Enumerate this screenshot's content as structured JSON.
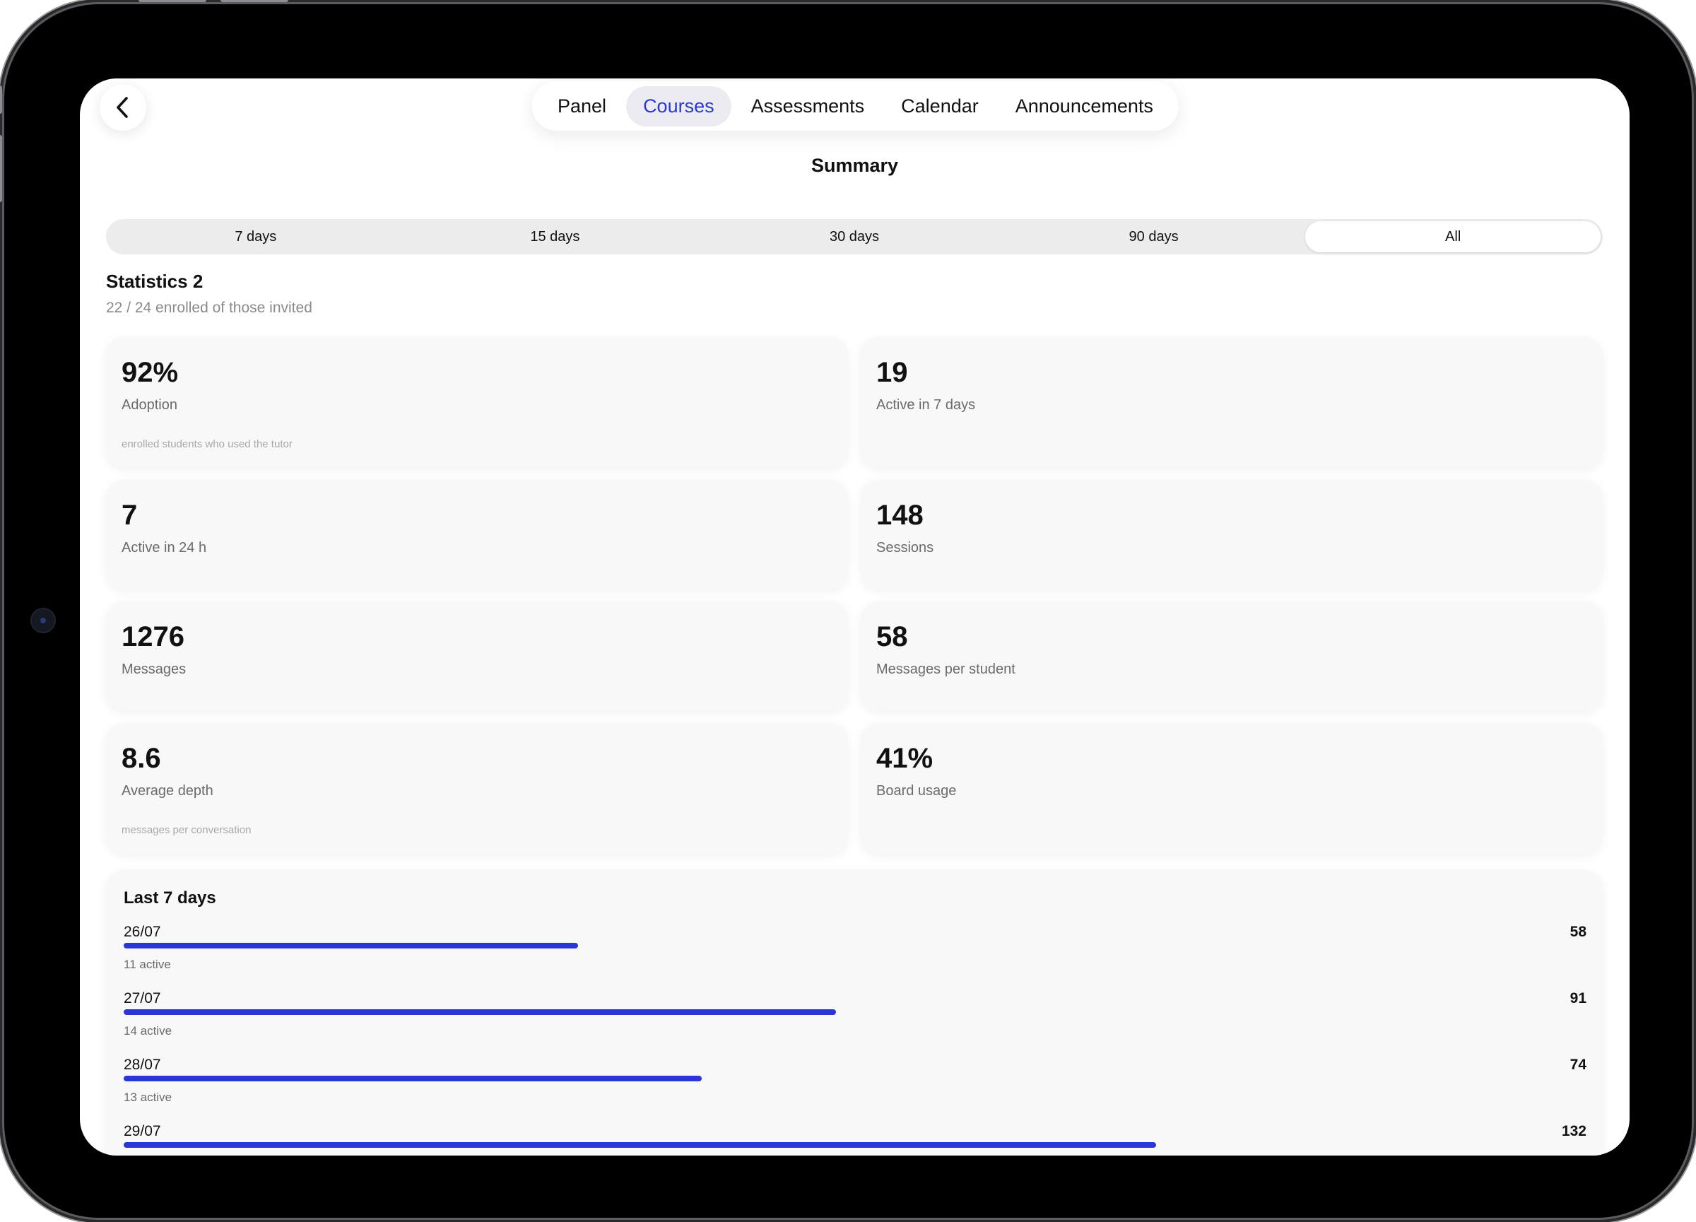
{
  "nav": {
    "tabs": [
      {
        "label": "Panel",
        "active": false
      },
      {
        "label": "Courses",
        "active": true
      },
      {
        "label": "Assessments",
        "active": false
      },
      {
        "label": "Calendar",
        "active": false
      },
      {
        "label": "Announcements",
        "active": false
      }
    ]
  },
  "page": {
    "title": "Summary"
  },
  "range": {
    "options": [
      "7 days",
      "15 days",
      "30 days",
      "90 days",
      "All"
    ],
    "selected": "All"
  },
  "stats": {
    "title": "Statistics 2",
    "subtitle": "22 / 24 enrolled of those invited",
    "cards": [
      {
        "value": "92%",
        "label": "Adoption",
        "note": "enrolled students who used the tutor"
      },
      {
        "value": "19",
        "label": "Active in 7 days",
        "note": ""
      },
      {
        "value": "7",
        "label": "Active in 24 h",
        "note": ""
      },
      {
        "value": "148",
        "label": "Sessions",
        "note": ""
      },
      {
        "value": "1276",
        "label": "Messages",
        "note": ""
      },
      {
        "value": "58",
        "label": "Messages per student",
        "note": ""
      },
      {
        "value": "8.6",
        "label": "Average depth",
        "note": "messages per conversation"
      },
      {
        "value": "41%",
        "label": "Board usage",
        "note": ""
      }
    ]
  },
  "week": {
    "title": "Last 7 days",
    "days": [
      {
        "date": "26/07",
        "count": "58",
        "active": "11 active",
        "fill": 0.44
      },
      {
        "date": "27/07",
        "count": "91",
        "active": "14 active",
        "fill": 0.69
      },
      {
        "date": "28/07",
        "count": "74",
        "active": "13 active",
        "fill": 0.56
      },
      {
        "date": "29/07",
        "count": "132",
        "active": "",
        "fill": 1.0
      }
    ]
  },
  "colors": {
    "accent": "#2b36d6",
    "card_bg": "#f8f8f8",
    "segment_bg": "#ececec"
  },
  "icons": {
    "back": "chevron-left-icon"
  }
}
